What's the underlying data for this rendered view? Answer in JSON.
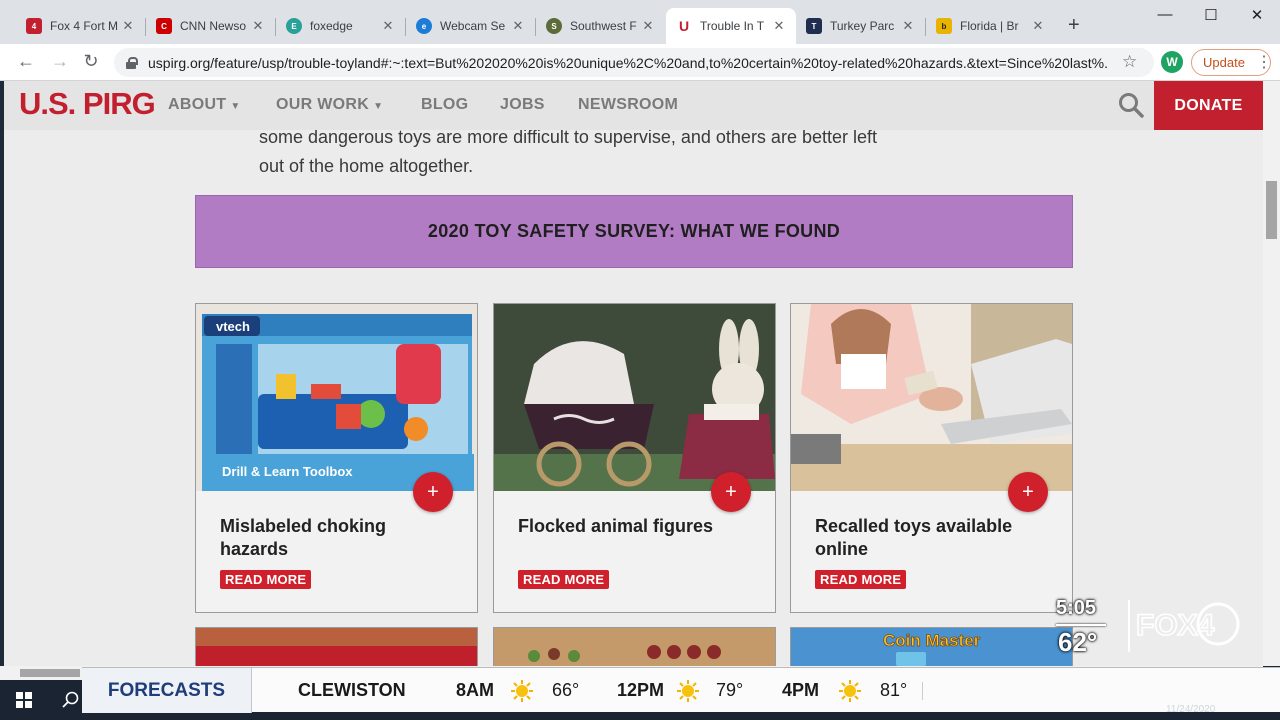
{
  "browser": {
    "tabs": [
      {
        "label": "Fox 4 Fort M",
        "icon": "fox4-favicon",
        "color": "#c3202f"
      },
      {
        "label": "CNN Newso",
        "icon": "cnn-favicon",
        "color": "#cc0000"
      },
      {
        "label": "foxedge",
        "icon": "foxedge-favicon",
        "color": "#2aa198"
      },
      {
        "label": "Webcam Se",
        "icon": "webcam-favicon",
        "color": "#1c7cd6"
      },
      {
        "label": "Southwest F",
        "icon": "southwest-favicon",
        "color": "#5b6b3a"
      },
      {
        "label": "Trouble In T",
        "icon": "uspirg-favicon",
        "color": "#c3202f"
      },
      {
        "label": "Turkey Parc",
        "icon": "turkey-favicon",
        "color": "#1f2d4f"
      },
      {
        "label": "Florida | Br",
        "icon": "florida-favicon",
        "color": "#e8b400"
      }
    ],
    "active_tab": 5,
    "url": "uspirg.org/feature/usp/trouble-toyland#:~:text=But%202020%20is%20unique%2C%20and,to%20certain%20toy-related%20hazards.&text=Since%20last%...",
    "profile_initial": "W",
    "update_label": "Update"
  },
  "site": {
    "logo": "U.S. PIRG",
    "brand_color": "#c3202f",
    "nav": [
      {
        "label": "ABOUT",
        "has_caret": true
      },
      {
        "label": "OUR WORK",
        "has_caret": true
      },
      {
        "label": "BLOG",
        "has_caret": false
      },
      {
        "label": "JOBS",
        "has_caret": false
      },
      {
        "label": "NEWSROOM",
        "has_caret": false
      }
    ],
    "donate_label": "DONATE"
  },
  "content": {
    "intro_line1": "some dangerous toys are more difficult to supervise, and others are better left",
    "intro_line2": "out of the home altogether.",
    "banner": "2020 TOY SAFETY SURVEY: WHAT WE FOUND",
    "banner_color": "#b27cc5",
    "cards": [
      {
        "title": "Mislabeled choking hazards",
        "read_more": "READ MORE",
        "plus": "+",
        "box_text": "Drill & Learn Toolbox",
        "box_brand": "vtech"
      },
      {
        "title": "Flocked animal figures",
        "read_more": "READ MORE",
        "plus": "+"
      },
      {
        "title": "Recalled toys available online",
        "read_more": "READ MORE",
        "plus": "+"
      }
    ],
    "next_row_card3_text": "Coin Master"
  },
  "overlay": {
    "forecasts_label": "FORECASTS",
    "city": "CLEWISTON",
    "forecast": [
      {
        "time": "8AM",
        "temp": "66°",
        "icon": "sun-icon"
      },
      {
        "time": "12PM",
        "temp": "79°",
        "icon": "sun-icon"
      },
      {
        "time": "4PM",
        "temp": "81°",
        "icon": "sun-icon"
      }
    ],
    "clock": "5:05",
    "current_temp": "62°",
    "station": "FOX4",
    "date": "11/24/2020"
  }
}
